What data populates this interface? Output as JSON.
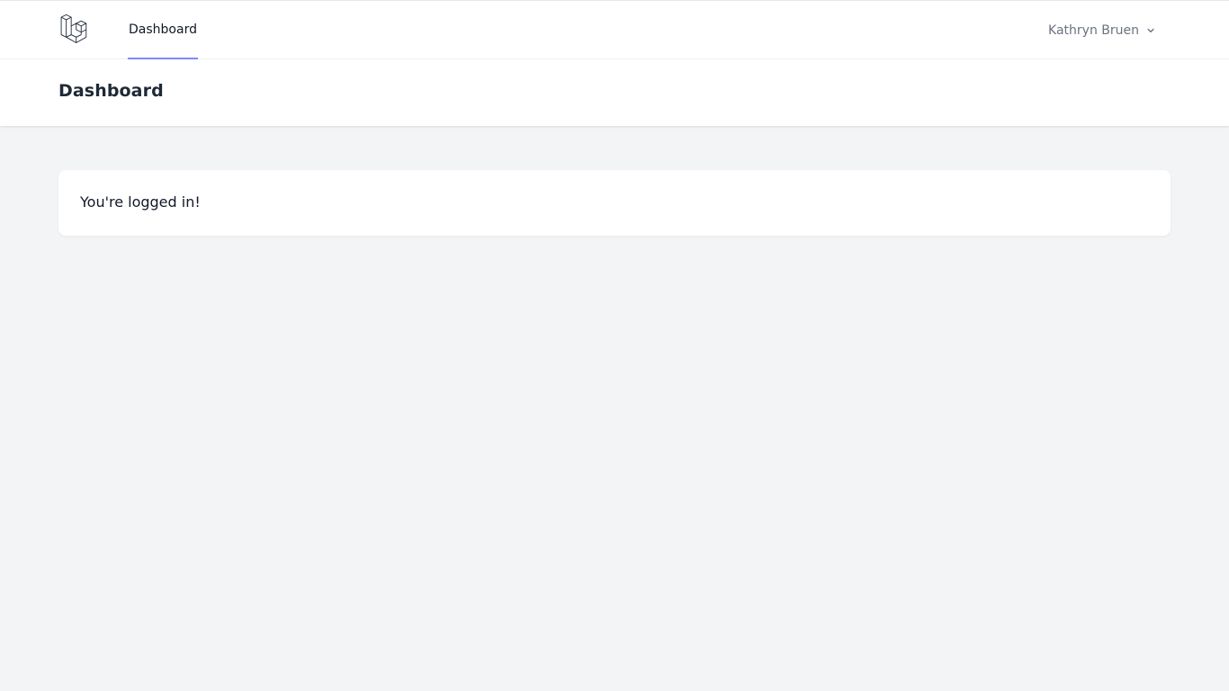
{
  "nav": {
    "logo_icon": "laravel-logo-icon",
    "links": [
      {
        "label": "Dashboard",
        "active": true
      }
    ],
    "user": {
      "name": "Kathryn Bruen",
      "dropdown_icon": "chevron-down-icon"
    },
    "active_underline_color": "#818cf8"
  },
  "header": {
    "title": "Dashboard"
  },
  "main": {
    "message": "You're logged in!"
  }
}
